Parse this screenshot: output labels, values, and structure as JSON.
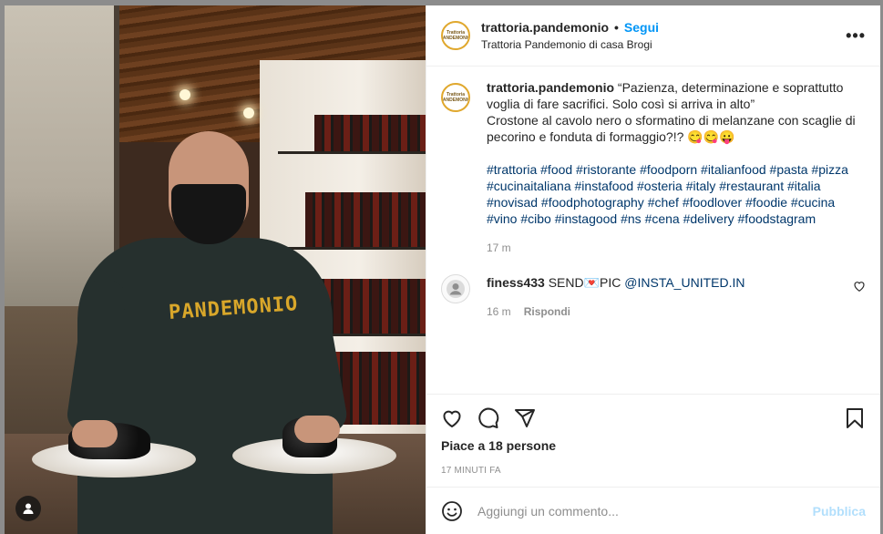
{
  "post": {
    "username": "trattoria.pandemonio",
    "separator": "•",
    "follow_label": "Segui",
    "location": "Trattoria Pandemonio di casa Brogi",
    "logo_text": "Trattoria PANDEMONIO",
    "more_icon": "more-horizontal-icon"
  },
  "photo": {
    "shirt_text": "PANDEMONIO",
    "user_tag_icon": "user-tag-icon"
  },
  "caption": {
    "username": "trattoria.pandemonio",
    "text_line1": "“Pazienza, determinazione e soprattutto voglia di fare sacrifici. Solo così si arriva in alto”",
    "text_line2": "Crostone al cavolo nero o sformatino di melanzane con scaglie di pecorino e fonduta di formaggio?!? 😋😋😛",
    "hashtags": "#trattoria #food #ristorante #foodporn #italianfood #pasta #pizza #cucinaitaliana #instafood #osteria #italy #restaurant #italia #novisad #foodphotography #chef #foodlover #foodie #cucina #vino #cibo #instagood #ns #cena #delivery #foodstagram",
    "time": "17 m"
  },
  "comment": {
    "username": "finess433",
    "text": "SEND💌PIC",
    "mention": "@INSTA_UNITED.IN",
    "time": "16 m",
    "reply_label": "Rispondi"
  },
  "actions": {
    "likes": "Piace a 18 persone",
    "age": "17 MINUTI FA",
    "icons": [
      "heart-icon",
      "comment-icon",
      "share-icon",
      "bookmark-icon"
    ]
  },
  "add_comment": {
    "placeholder": "Aggiungi un commento...",
    "publish_label": "Pubblica",
    "emoji_icon": "emoji-icon"
  },
  "colors": {
    "link": "#0095f6",
    "hashtag": "#00376b",
    "muted": "#8e8e8e",
    "publish_disabled": "#b2dffc"
  }
}
